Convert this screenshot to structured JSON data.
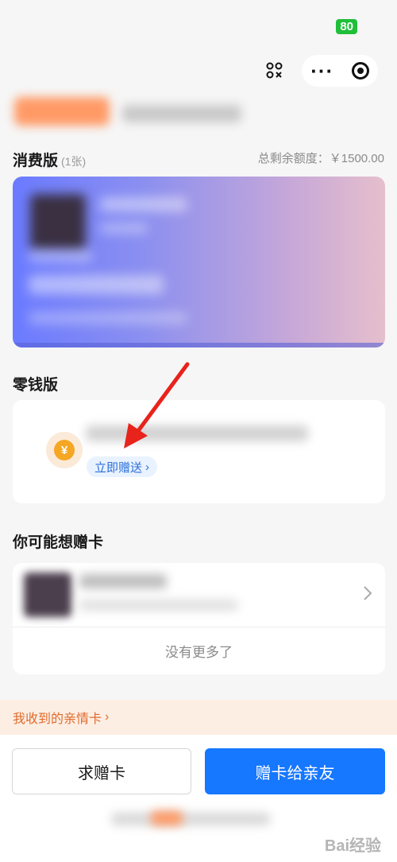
{
  "status_bar": {
    "battery": "80"
  },
  "consume_section": {
    "title": "消费版",
    "count": "(1张)",
    "total_label": "总剩余额度：￥1500.00"
  },
  "change_section": {
    "title": "零钱版",
    "coin_symbol": "¥",
    "send_now": "立即赠送",
    "send_now_chevron": "›"
  },
  "suggest_section": {
    "title": "你可能想赠卡",
    "no_more": "没有更多了"
  },
  "received_bar": {
    "label": "我收到的亲情卡",
    "chevron": "›"
  },
  "footer": {
    "ask_button": "求赠卡",
    "give_button": "赠卡给亲友",
    "watermark": "Bai经验"
  },
  "colors": {
    "primary": "#1677ff",
    "accent_orange": "#e06c2c",
    "annotation_red": "#e8231c",
    "card_gradient_start": "#6b7bff",
    "card_gradient_end": "#e6bfcc"
  }
}
